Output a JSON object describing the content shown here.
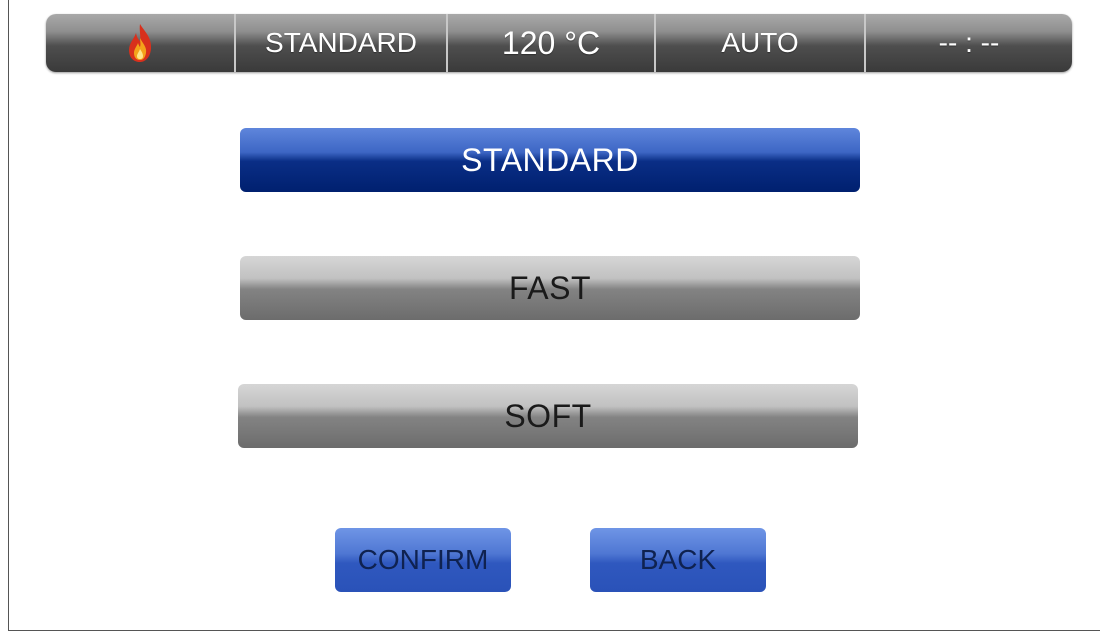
{
  "status_bar": {
    "flame_icon": "flame-icon",
    "program": "STANDARD",
    "temperature": "120  °C",
    "mode": "AUTO",
    "time": "-- : --"
  },
  "options": [
    {
      "label": "STANDARD",
      "selected": true
    },
    {
      "label": "FAST",
      "selected": false
    },
    {
      "label": "SOFT",
      "selected": false
    }
  ],
  "actions": {
    "confirm": "CONFIRM",
    "back": "BACK"
  },
  "colors": {
    "selected": "#0a2e86",
    "unselected": "#838383",
    "action": "#2f58bf"
  }
}
